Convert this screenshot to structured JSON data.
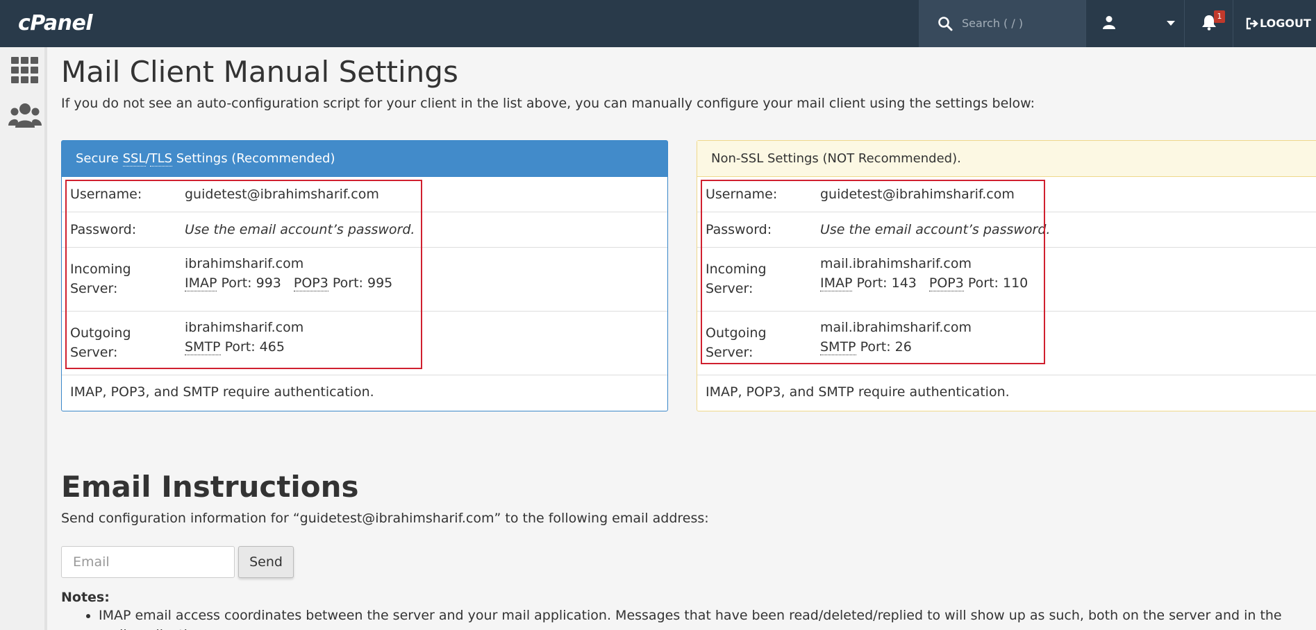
{
  "app": {
    "logo": "cPanel",
    "search_placeholder": "Search ( / )",
    "notification_count": "1",
    "logout_label": "LOGOUT"
  },
  "page": {
    "title": "Mail Client Manual Settings",
    "intro": "If you do not see an auto-configuration script for your client in the list above, you can manually configure your mail client using the settings below:"
  },
  "ssl": {
    "heading_prefix": "Secure ",
    "heading_ssl": "SSL",
    "heading_sep": "/",
    "heading_tls": "TLS",
    "heading_suffix": " Settings (Recommended)",
    "username_label": "Username:",
    "username": "guidetest@ibrahimsharif.com",
    "password_label": "Password:",
    "password": "Use the email account’s password.",
    "incoming_label": "Incoming Server:",
    "incoming_host": "ibrahimsharif.com",
    "imap_abbr": "IMAP",
    "imap_port": " Port: 993",
    "pop3_abbr": "POP3",
    "pop3_port": " Port: 995",
    "outgoing_label": "Outgoing Server:",
    "outgoing_host": "ibrahimsharif.com",
    "smtp_abbr": "SMTP",
    "smtp_port": " Port: 465",
    "auth_note": "IMAP, POP3, and SMTP require authentication."
  },
  "nonssl": {
    "heading": "Non-SSL Settings (NOT Recommended).",
    "username_label": "Username:",
    "username": "guidetest@ibrahimsharif.com",
    "password_label": "Password:",
    "password": "Use the email account’s password.",
    "incoming_label": "Incoming Server:",
    "incoming_host": "mail.ibrahimsharif.com",
    "imap_abbr": "IMAP",
    "imap_port": " Port: 143",
    "pop3_abbr": "POP3",
    "pop3_port": " Port: 110",
    "outgoing_label": "Outgoing Server:",
    "outgoing_host": "mail.ibrahimsharif.com",
    "smtp_abbr": "SMTP",
    "smtp_port": " Port: 26",
    "auth_note": "IMAP, POP3, and SMTP require authentication."
  },
  "instructions": {
    "title": "Email Instructions",
    "send_info": "Send configuration information for “guidetest@ibrahimsharif.com” to the following email address:",
    "email_placeholder": "Email",
    "send_label": "Send",
    "notes_title": "Notes:",
    "note_1": "IMAP email access coordinates between the server and your mail application. Messages that have been read/deleted/replied to will show up as such, both on the server and in the mail application."
  },
  "colors": {
    "topbar": "#293a4a",
    "ssl_heading": "#428bca",
    "nonssl_heading": "#fcf8e3",
    "highlight": "#d0202f"
  }
}
